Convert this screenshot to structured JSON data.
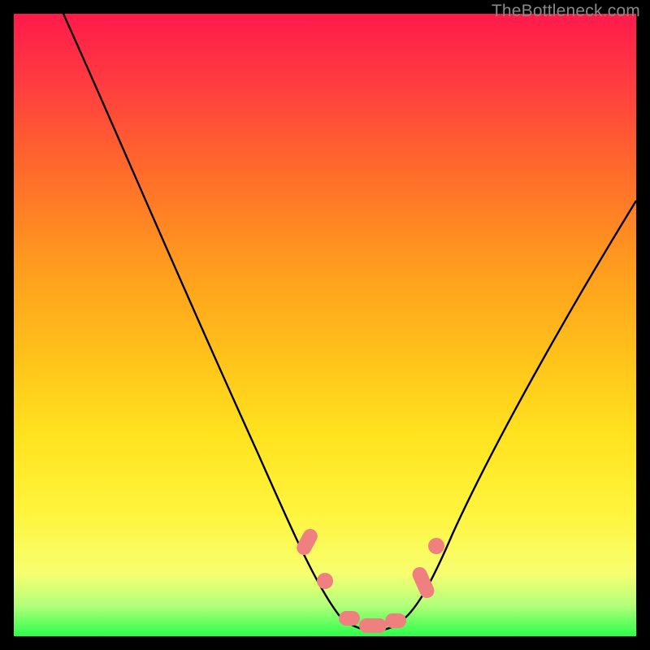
{
  "watermark": "TheBottleneck.com",
  "chart_data": {
    "type": "line",
    "title": "",
    "xlabel": "",
    "ylabel": "",
    "xlim": [
      0,
      100
    ],
    "ylim": [
      0,
      100
    ],
    "series": [
      {
        "name": "bottleneck-curve",
        "x": [
          8,
          15,
          22,
          30,
          38,
          44,
          48,
          51,
          54,
          57,
          60,
          63,
          67,
          72,
          80,
          90,
          100
        ],
        "y": [
          100,
          88,
          75,
          60,
          44,
          30,
          18,
          10,
          5,
          3,
          3,
          5,
          10,
          18,
          32,
          50,
          70
        ]
      }
    ],
    "markers": [
      {
        "name": "left-upper-marker",
        "x": 47.5,
        "y": 15
      },
      {
        "name": "left-lower-marker",
        "x": 50,
        "y": 9
      },
      {
        "name": "valley-left-marker",
        "x": 54,
        "y": 4
      },
      {
        "name": "valley-center-marker",
        "x": 57.5,
        "y": 3
      },
      {
        "name": "valley-right-marker",
        "x": 61,
        "y": 4
      },
      {
        "name": "right-lower-marker",
        "x": 65,
        "y": 8.5
      },
      {
        "name": "right-upper-marker",
        "x": 67.5,
        "y": 13
      }
    ],
    "colors": {
      "curve": "#000000",
      "marker": "#f08080",
      "gradient_top": "#ff1a4b",
      "gradient_bottom": "#2bff4a"
    }
  }
}
